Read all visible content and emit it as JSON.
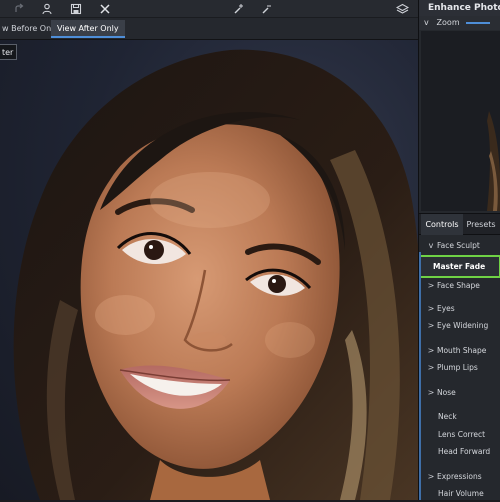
{
  "toolbar": {
    "icons": [
      "redo-icon",
      "person-icon",
      "save-icon",
      "close-icon",
      "brush-add-icon",
      "brush-remove-icon",
      "layers-icon"
    ]
  },
  "view_bar": {
    "before_label": "w Before Only",
    "after_label": "View After Only"
  },
  "canvas": {
    "badge_text": "ter",
    "image_description_name": "portrait-photo"
  },
  "panel": {
    "title": "Enhance Photo",
    "zoom_label": "Zoom",
    "tabs": [
      "Controls",
      "Presets"
    ]
  },
  "controls": {
    "items": [
      {
        "label": "Face Sculpt",
        "chevron": "v"
      },
      {
        "label": "Master Fade",
        "chevron": ""
      },
      {
        "label": "Face Shape",
        "chevron": ">"
      },
      {
        "label": "Eyes",
        "chevron": ">"
      },
      {
        "label": "Eye Widening",
        "chevron": ">"
      },
      {
        "label": "Mouth Shape",
        "chevron": ">"
      },
      {
        "label": "Plump Lips",
        "chevron": ">"
      },
      {
        "label": "Nose",
        "chevron": ">"
      },
      {
        "label": "Neck",
        "chevron": ""
      },
      {
        "label": "Lens Correct",
        "chevron": ""
      },
      {
        "label": "Head Forward",
        "chevron": ""
      },
      {
        "label": "Expressions",
        "chevron": ">"
      },
      {
        "label": "Hair Volume",
        "chevron": ""
      }
    ]
  },
  "colors": {
    "accent": "#4e8ed8",
    "selected_border": "#6fd245"
  }
}
